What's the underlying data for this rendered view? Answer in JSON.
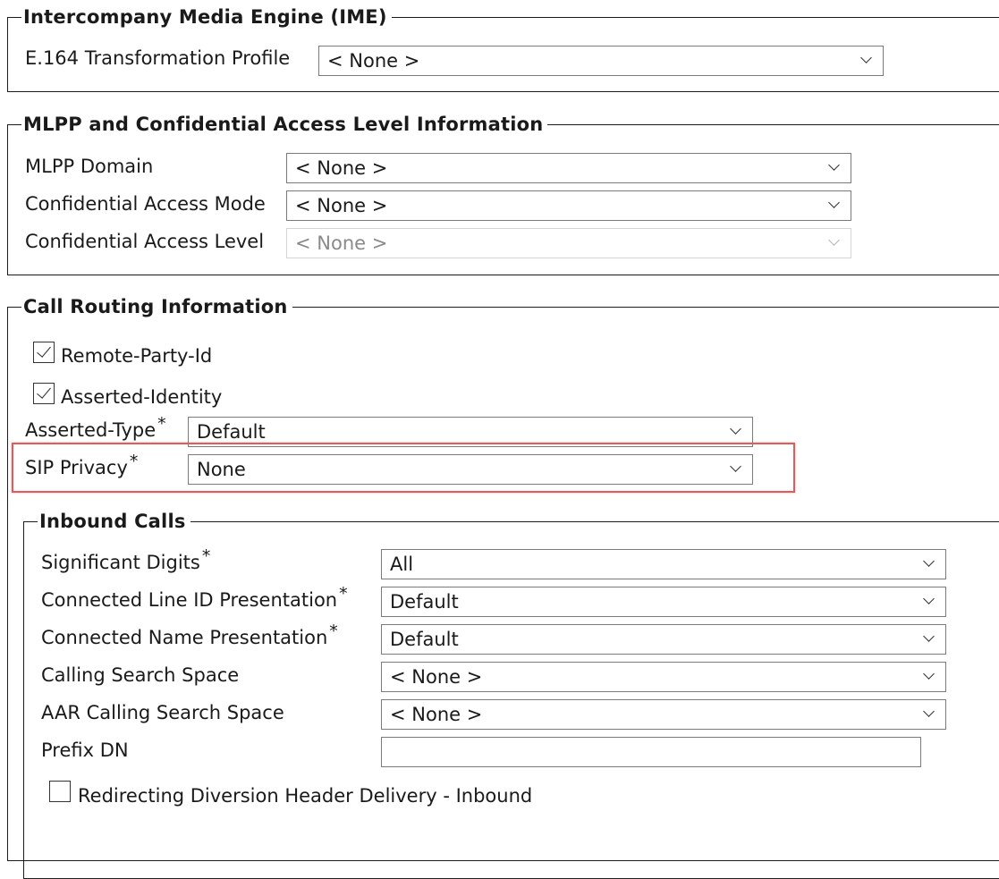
{
  "ime": {
    "legend": "Intercompany Media Engine (IME)",
    "e164_label": "E.164 Transformation Profile",
    "e164_value": "< None >"
  },
  "mlpp": {
    "legend": "MLPP and Confidential Access Level Information",
    "domain_label": "MLPP Domain",
    "domain_value": "< None >",
    "mode_label": "Confidential Access Mode",
    "mode_value": "< None >",
    "level_label": "Confidential Access Level",
    "level_value": "< None >"
  },
  "routing": {
    "legend": "Call Routing Information",
    "remote_party_id_label": "Remote-Party-Id",
    "remote_party_id_checked": true,
    "asserted_identity_label": "Asserted-Identity",
    "asserted_identity_checked": true,
    "asserted_type_label": "Asserted-Type",
    "asserted_type_value": "Default",
    "sip_privacy_label": "SIP Privacy",
    "sip_privacy_value": "None",
    "required_marker": "*",
    "highlight_color": "#e35a5a"
  },
  "inbound": {
    "legend": "Inbound Calls",
    "significant_digits_label": "Significant Digits",
    "significant_digits_value": "All",
    "connected_line_label": "Connected Line ID Presentation",
    "connected_line_value": "Default",
    "connected_name_label": "Connected Name Presentation",
    "connected_name_value": "Default",
    "css_label": "Calling Search Space",
    "css_value": "< None >",
    "aar_css_label": "AAR Calling Search Space",
    "aar_css_value": "< None >",
    "prefix_dn_label": "Prefix DN",
    "prefix_dn_value": "",
    "redirecting_label": "Redirecting Diversion Header Delivery - Inbound",
    "redirecting_checked": false
  }
}
